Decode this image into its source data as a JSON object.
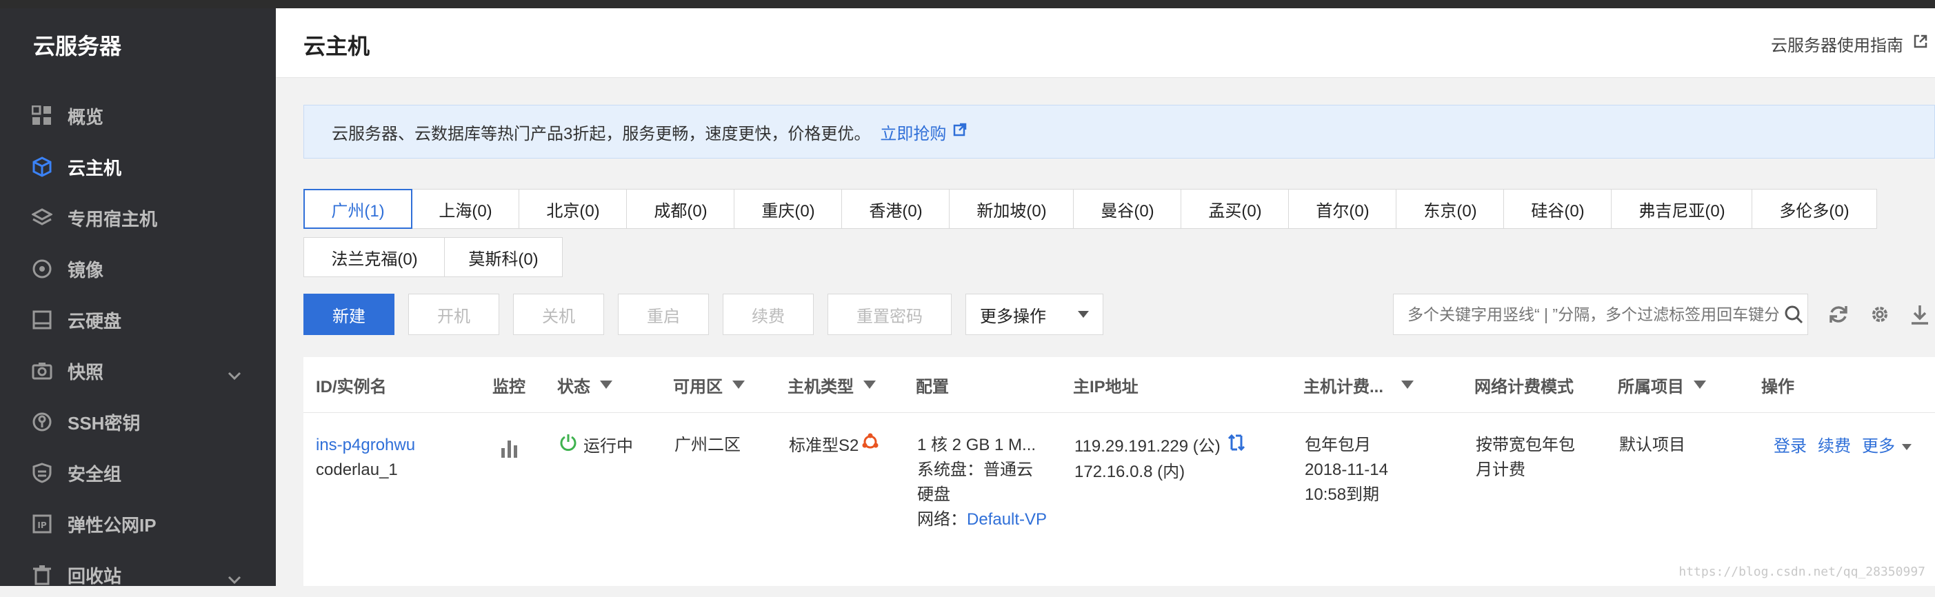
{
  "sidebar": {
    "title": "云服务器",
    "items": [
      {
        "label": "概览",
        "icon": "grid-icon"
      },
      {
        "label": "云主机",
        "icon": "cube-icon",
        "active": true
      },
      {
        "label": "专用宿主机",
        "icon": "layers-icon"
      },
      {
        "label": "镜像",
        "icon": "disc-icon"
      },
      {
        "label": "云硬盘",
        "icon": "disk-icon"
      },
      {
        "label": "快照",
        "icon": "camera-icon",
        "expandable": true
      },
      {
        "label": "SSH密钥",
        "icon": "key-icon"
      },
      {
        "label": "安全组",
        "icon": "shield-icon"
      },
      {
        "label": "弹性公网IP",
        "icon": "ip-icon"
      },
      {
        "label": "回收站",
        "icon": "trash-icon",
        "expandable": true
      }
    ]
  },
  "header": {
    "title": "云主机",
    "guide_label": "云服务器使用指南"
  },
  "notice": {
    "text": "云服务器、云数据库等热门产品3折起，服务更畅，速度更快，价格更优。",
    "link_label": "立即抢购"
  },
  "regions": [
    "广州(1)",
    "上海(0)",
    "北京(0)",
    "成都(0)",
    "重庆(0)",
    "香港(0)",
    "新加坡(0)",
    "曼谷(0)",
    "孟买(0)",
    "首尔(0)",
    "东京(0)",
    "硅谷(0)",
    "弗吉尼亚(0)",
    "多伦多(0)",
    "法兰克福(0)",
    "莫斯科(0)"
  ],
  "active_region": "广州(1)",
  "toolbar": {
    "new_label": "新建",
    "start_label": "开机",
    "stop_label": "关机",
    "restart_label": "重启",
    "renew_label": "续费",
    "reset_pwd_label": "重置密码",
    "more_label": "更多操作",
    "search_placeholder": "多个关键字用竖线“ | ”分隔，多个过滤标签用回车键分隔"
  },
  "table": {
    "headers": {
      "id": "ID/实例名",
      "monitor": "监控",
      "status": "状态",
      "zone": "可用区",
      "type": "主机类型",
      "config": "配置",
      "ip": "主IP地址",
      "billing": "主机计费...",
      "net_billing": "网络计费模式",
      "project": "所属项目",
      "ops": "操作"
    },
    "rows": [
      {
        "id": "ins-p4grohwu",
        "name": "coderlau_1",
        "status": "运行中",
        "zone": "广州二区",
        "type": "标准型S2",
        "config_line1": "1 核 2 GB 1 M...",
        "config_disk_a": "系统盘：普通云",
        "config_disk_b": "硬盘",
        "config_net_label": "网络：",
        "config_net_value": "Default-VP",
        "ip_public": "119.29.191.229 (公)",
        "ip_private": "172.16.0.8 (内)",
        "billing_mode": "包年包月",
        "billing_date": "2018-11-14",
        "billing_expire": "10:58到期",
        "net_billing_a": "按带宽包年包",
        "net_billing_b": "月计费",
        "project": "默认项目",
        "op_login": "登录",
        "op_renew": "续费",
        "op_more": "更多"
      }
    ]
  },
  "colors": {
    "accent": "#2f6fd8",
    "sidebar_bg": "#2e2f33",
    "running": "#3fb24f"
  },
  "watermark": "https://blog.csdn.net/qq_28350997"
}
